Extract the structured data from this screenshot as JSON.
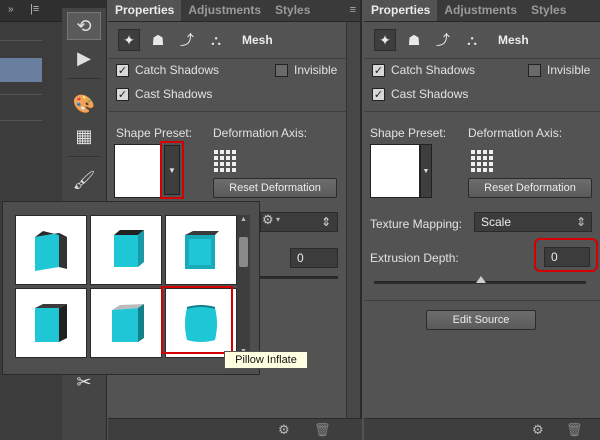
{
  "left_panel": {
    "tabs": [
      "Properties",
      "Adjustments",
      "Styles"
    ],
    "mode_label": "Mesh",
    "catch_shadows": "Catch Shadows",
    "invisible": "Invisible",
    "cast_shadows": "Cast Shadows",
    "shape_preset": "Shape Preset:",
    "deformation_axis": "Deformation Axis:",
    "reset_deformation": "Reset Deformation",
    "extrusion_value": "0"
  },
  "right_panel": {
    "tabs": [
      "Properties",
      "Adjustments",
      "Styles"
    ],
    "mode_label": "Mesh",
    "catch_shadows": "Catch Shadows",
    "invisible": "Invisible",
    "cast_shadows": "Cast Shadows",
    "shape_preset": "Shape Preset:",
    "deformation_axis": "Deformation Axis:",
    "reset_deformation": "Reset Deformation",
    "texture_mapping_label": "Texture Mapping:",
    "texture_mapping_value": "Scale",
    "extrusion_depth_label": "Extrusion Depth:",
    "extrusion_depth_value": "0",
    "edit_source": "Edit Source"
  },
  "popup": {
    "tooltip": "Pillow Inflate"
  },
  "icons": {
    "mesh_mode": "mesh-star-icon",
    "deform": "deform-icon",
    "cap": "cap-icon",
    "coordinates": "coordinates-icon",
    "gear": "gear-icon",
    "trash": "trash-icon"
  },
  "colors": {
    "highlight": "#d40000",
    "cube_cyan": "#1fc7d6"
  }
}
